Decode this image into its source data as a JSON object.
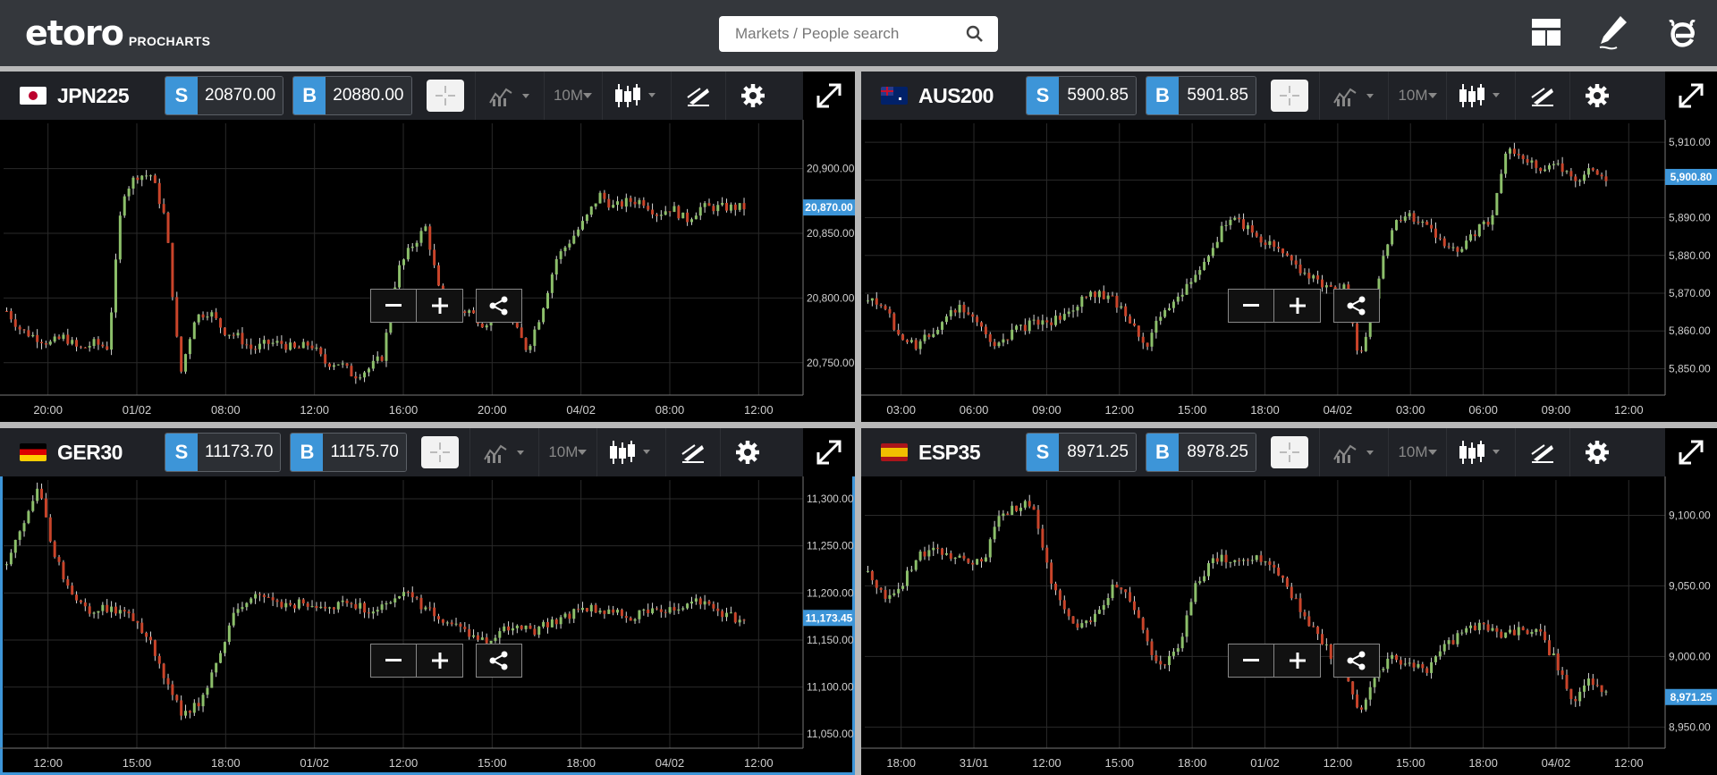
{
  "app": {
    "logo_text": "etoro",
    "logo_sub": "PROCHARTS",
    "search_placeholder": "Markets / People search"
  },
  "colors": {
    "accent": "#3d95d8",
    "up": "#8cbf6a",
    "down": "#c9442a",
    "background": "#000000",
    "toolbar": "#202227"
  },
  "panels": [
    {
      "symbol": "JPN225",
      "flag": "jp",
      "sell_label": "S",
      "sell": "20870.00",
      "buy_label": "B",
      "buy": "20880.00",
      "timeframe": "10M",
      "current_price": "20,870.00",
      "chart_data": {
        "type": "candlestick",
        "series": [
          {
            "values": [
              20790,
              20775,
              20770,
              20765,
              20770,
              20760,
              20765,
              20762,
              20880,
              20895,
              20895,
              20860,
              20740,
              20785,
              20790,
              20775,
              20770,
              20760,
              20765,
              20765,
              20760,
              20765,
              20750,
              20750,
              20740,
              20745,
              20755,
              20820,
              20840,
              20855,
              20800,
              20790,
              20790,
              20780,
              20790,
              20780,
              20760,
              20790,
              20830,
              20845,
              20860,
              20880,
              20870,
              20875,
              20875,
              20865,
              20870,
              20860,
              20870,
              20870,
              20870,
              20870
            ]
          }
        ],
        "yticks": [
          "20,900.00",
          "20,850.00",
          "20,800.00",
          "20,750.00"
        ],
        "xticks": [
          "20:00",
          "01/02",
          "08:00",
          "12:00",
          "16:00",
          "20:00",
          "04/02",
          "08:00",
          "12:00"
        ],
        "ylim": [
          20725,
          20935
        ]
      }
    },
    {
      "symbol": "AUS200",
      "flag": "au",
      "sell_label": "S",
      "sell": "5900.85",
      "buy_label": "B",
      "buy": "5901.85",
      "timeframe": "10M",
      "current_price": "5,900.80",
      "chart_data": {
        "type": "candlestick",
        "series": [
          {
            "values": [
              5868,
              5866,
              5858,
              5856,
              5860,
              5866,
              5866,
              5860,
              5856,
              5860,
              5862,
              5862,
              5864,
              5868,
              5870,
              5868,
              5863,
              5856,
              5866,
              5868,
              5876,
              5882,
              5890,
              5888,
              5884,
              5882,
              5878,
              5874,
              5872,
              5872,
              5852,
              5872,
              5888,
              5891,
              5888,
              5884,
              5880,
              5886,
              5890,
              5908,
              5906,
              5902,
              5904,
              5900,
              5902,
              5900
            ]
          }
        ],
        "yticks": [
          "5,910.00",
          "5,900.00",
          "5,890.00",
          "5,880.00",
          "5,870.00",
          "5,860.00",
          "5,850.00"
        ],
        "xticks": [
          "03:00",
          "06:00",
          "09:00",
          "12:00",
          "15:00",
          "18:00",
          "04/02",
          "03:00",
          "06:00",
          "09:00",
          "12:00"
        ],
        "ylim": [
          5843,
          5915
        ]
      }
    },
    {
      "symbol": "GER30",
      "flag": "de",
      "sell_label": "S",
      "sell": "11173.70",
      "buy_label": "B",
      "buy": "11175.70",
      "timeframe": "10M",
      "current_price": "11,173.45",
      "chart_data": {
        "type": "candlestick",
        "series": [
          {
            "values": [
              11230,
              11270,
              11310,
              11240,
              11200,
              11180,
              11185,
              11180,
              11170,
              11150,
              11100,
              11070,
              11085,
              11120,
              11170,
              11195,
              11195,
              11190,
              11188,
              11190,
              11185,
              11190,
              11185,
              11178,
              11190,
              11200,
              11185,
              11175,
              11165,
              11155,
              11150,
              11160,
              11165,
              11160,
              11170,
              11175,
              11185,
              11180,
              11178,
              11175,
              11180,
              11182,
              11185,
              11195,
              11185,
              11175,
              11172
            ]
          }
        ],
        "yticks": [
          "11,300.00",
          "11,250.00",
          "11,200.00",
          "11,150.00",
          "11,100.00",
          "11,050.00"
        ],
        "xticks": [
          "12:00",
          "15:00",
          "18:00",
          "01/02",
          "12:00",
          "15:00",
          "18:00",
          "04/02",
          "12:00"
        ],
        "ylim": [
          11035,
          11320
        ]
      }
    },
    {
      "symbol": "ESP35",
      "flag": "es",
      "sell_label": "S",
      "sell": "8971.25",
      "buy_label": "B",
      "buy": "8978.25",
      "timeframe": "10M",
      "current_price": "8,971.25",
      "chart_data": {
        "type": "candlestick",
        "series": [
          {
            "values": [
              9060,
              9040,
              9050,
              9070,
              9075,
              9072,
              9070,
              9065,
              9100,
              9105,
              9110,
              9060,
              9030,
              9020,
              9030,
              9050,
              9040,
              9010,
              8990,
              9010,
              9050,
              9068,
              9070,
              9065,
              9070,
              9060,
              9040,
              9020,
              9005,
              8990,
              8960,
              8985,
              9000,
              8995,
              8990,
              9005,
              9015,
              9022,
              9018,
              9015,
              9020,
              9015,
              8995,
              8965,
              8985,
              8975
            ]
          }
        ],
        "yticks": [
          "9,100.00",
          "9,050.00",
          "9,000.00",
          "8,950.00"
        ],
        "xticks": [
          "18:00",
          "31/01",
          "12:00",
          "15:00",
          "18:00",
          "01/02",
          "12:00",
          "15:00",
          "18:00",
          "04/02",
          "12:00"
        ],
        "ylim": [
          8935,
          9125
        ]
      }
    }
  ]
}
